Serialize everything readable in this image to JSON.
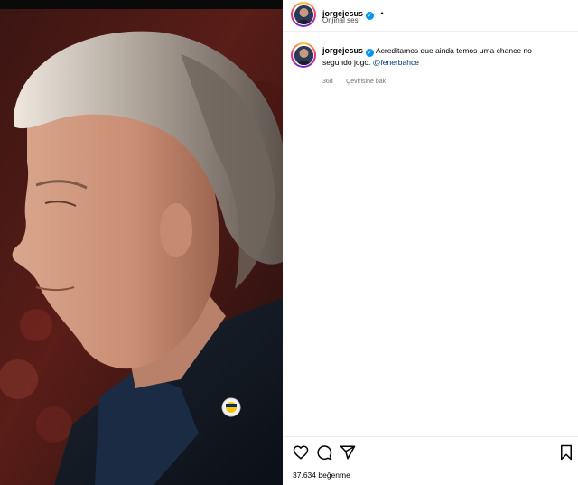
{
  "header": {
    "username": "jorgejesus",
    "dot": "•",
    "audio_label": "Orijinal ses"
  },
  "caption": {
    "username": "jorgejesus",
    "text_line1": "Acreditamos que ainda temos uma chance no",
    "text_line2": "segundo jogo.",
    "mention": "@fenerbahce",
    "time": "36d",
    "translate_label": "Çevirisine bak"
  },
  "actions": {
    "like_icon": "heart-icon",
    "comment_icon": "comment-icon",
    "share_icon": "share-icon",
    "save_icon": "bookmark-icon"
  },
  "likes": {
    "text": "37.634 beğenme"
  },
  "colors": {
    "verified": "#0095f6",
    "mention": "#00376b",
    "meta": "#737373"
  }
}
